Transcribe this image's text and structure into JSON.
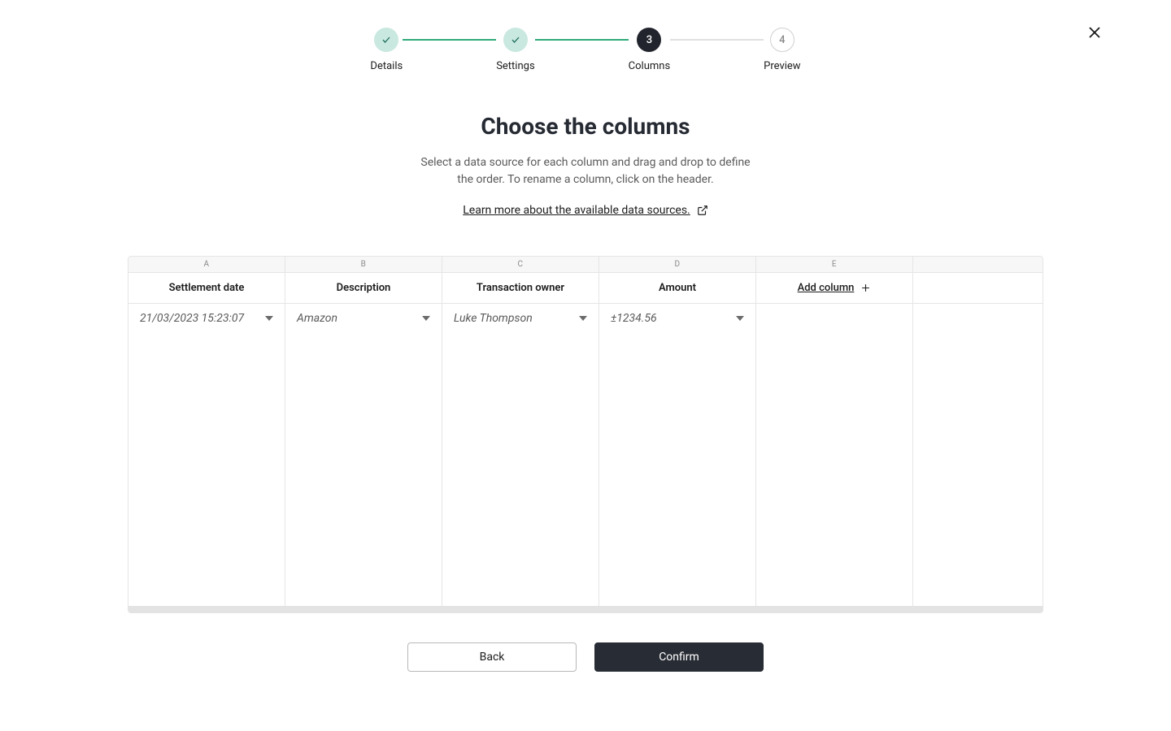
{
  "stepper": {
    "steps": [
      {
        "label": "Details",
        "state": "completed"
      },
      {
        "label": "Settings",
        "state": "completed"
      },
      {
        "label": "Columns",
        "state": "current",
        "number": "3"
      },
      {
        "label": "Preview",
        "state": "upcoming",
        "number": "4"
      }
    ]
  },
  "header": {
    "title": "Choose the columns",
    "subtitle": "Select a data source for each column and drag and drop to define the order. To rename a column, click on the header.",
    "learn_more": "Learn more about the available data sources."
  },
  "table": {
    "letters": [
      "A",
      "B",
      "C",
      "D",
      "E"
    ],
    "columns": [
      {
        "header": "Settlement date",
        "value": "21/03/2023 15:23:07"
      },
      {
        "header": "Description",
        "value": "Amazon"
      },
      {
        "header": "Transaction owner",
        "value": "Luke Thompson"
      },
      {
        "header": "Amount",
        "value": "±1234.56"
      }
    ],
    "add_column_label": "Add column"
  },
  "footer": {
    "back_label": "Back",
    "confirm_label": "Confirm"
  }
}
